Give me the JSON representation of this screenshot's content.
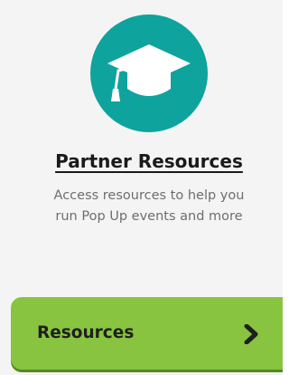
{
  "card": {
    "icon": "graduation-cap-icon",
    "title": "Partner Resources",
    "description_lines": [
      "Access resources to help you",
      "run Pop Up events and more"
    ],
    "button": {
      "label": "Resources",
      "icon": "chevron-right-icon"
    }
  },
  "colors": {
    "icon_circle": "#0fa39e",
    "button_background": "#88c440",
    "button_shadow": "#558a22",
    "title_text": "#1a1a1a",
    "description_text": "#6e6e6e",
    "card_background": "#f4f4f4"
  }
}
